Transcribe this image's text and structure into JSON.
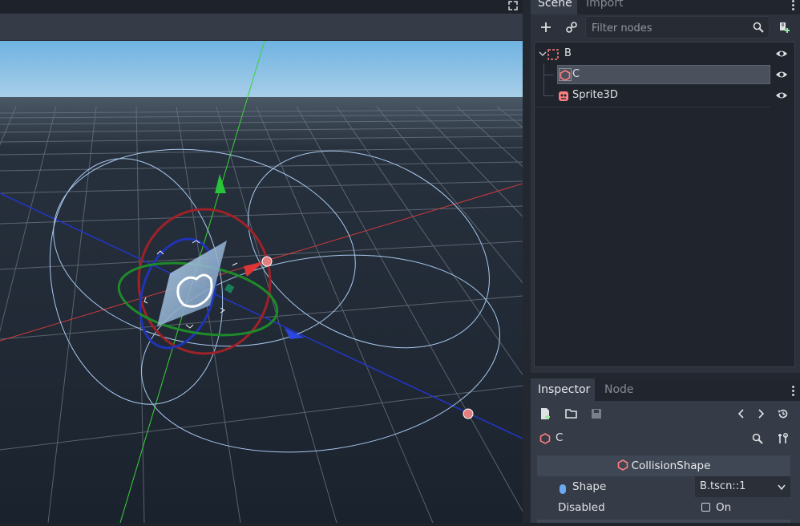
{
  "viewport": {
    "maximize_icon": "expand-icon",
    "colors": {
      "sky_top": "#6fb3e2",
      "sky_horizon": "#a9cfe8",
      "ground": "#1c2430",
      "grid": "#6d7682"
    }
  },
  "scene_dock": {
    "tabs": [
      {
        "label": "Scene",
        "active": true
      },
      {
        "label": "Import",
        "active": false
      }
    ],
    "toolbar": {
      "add_icon": "plus-icon",
      "link_icon": "link-icon",
      "search_icon": "search-icon",
      "script_icon": "add-script-icon"
    },
    "filter": {
      "placeholder": "Filter nodes",
      "value": ""
    },
    "tree": [
      {
        "label": "B",
        "icon": "spatial-node-icon",
        "expanded": true,
        "selected": false,
        "visible": true
      },
      {
        "label": "C",
        "icon": "collision-shape-icon",
        "selected": true,
        "visible": true
      },
      {
        "label": "Sprite3D",
        "icon": "sprite3d-icon",
        "selected": false,
        "visible": true
      }
    ]
  },
  "inspector_dock": {
    "tabs": [
      {
        "label": "Inspector",
        "active": true
      },
      {
        "label": "Node",
        "active": false
      }
    ],
    "object_name": "C",
    "section_title": "CollisionShape",
    "properties": {
      "shape": {
        "label": "Shape",
        "value": "B.tscn::1"
      },
      "disabled": {
        "label": "Disabled",
        "checked": false,
        "check_label": "On"
      }
    }
  }
}
